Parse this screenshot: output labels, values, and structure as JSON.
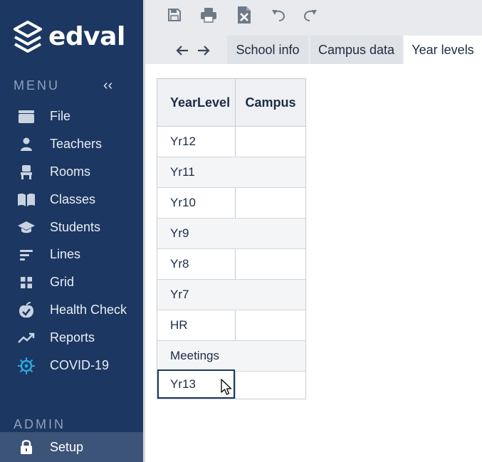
{
  "brand": {
    "name": "edval"
  },
  "sidebar": {
    "menu_title": "MENU",
    "collapse_glyph": "‹‹",
    "admin_title": "ADMIN",
    "items": [
      {
        "label": "File",
        "icon": "folder-icon"
      },
      {
        "label": "Teachers",
        "icon": "person-icon"
      },
      {
        "label": "Rooms",
        "icon": "chair-icon"
      },
      {
        "label": "Classes",
        "icon": "book-icon"
      },
      {
        "label": "Students",
        "icon": "graduation-cap-icon"
      },
      {
        "label": "Lines",
        "icon": "lines-icon"
      },
      {
        "label": "Grid",
        "icon": "grid-icon"
      },
      {
        "label": "Health Check",
        "icon": "apple-icon"
      },
      {
        "label": "Reports",
        "icon": "trend-icon"
      },
      {
        "label": "COVID-19",
        "icon": "virus-icon"
      }
    ],
    "admin_items": [
      {
        "label": "Setup",
        "icon": "lock-icon",
        "active": true
      }
    ]
  },
  "tabs": [
    {
      "label": "School info",
      "active": false
    },
    {
      "label": "Campus data",
      "active": false
    },
    {
      "label": "Year levels",
      "active": true
    }
  ],
  "table": {
    "columns": [
      "YearLevel",
      "Campus"
    ],
    "rows": [
      {
        "year": "Yr12",
        "campus": ""
      },
      {
        "year": "Yr11",
        "campus": ""
      },
      {
        "year": "Yr10",
        "campus": ""
      },
      {
        "year": "Yr9",
        "campus": ""
      },
      {
        "year": "Yr8",
        "campus": ""
      },
      {
        "year": "Yr7",
        "campus": ""
      },
      {
        "year": "HR",
        "campus": ""
      },
      {
        "year": "Meetings",
        "campus": ""
      },
      {
        "year": "Yr13",
        "campus": ""
      }
    ]
  },
  "colors": {
    "sidebar_bg": "#1c3761",
    "active_item_bg": "#3c5478",
    "covid_accent": "#29a8e0",
    "text_dark": "#1b2c45"
  }
}
